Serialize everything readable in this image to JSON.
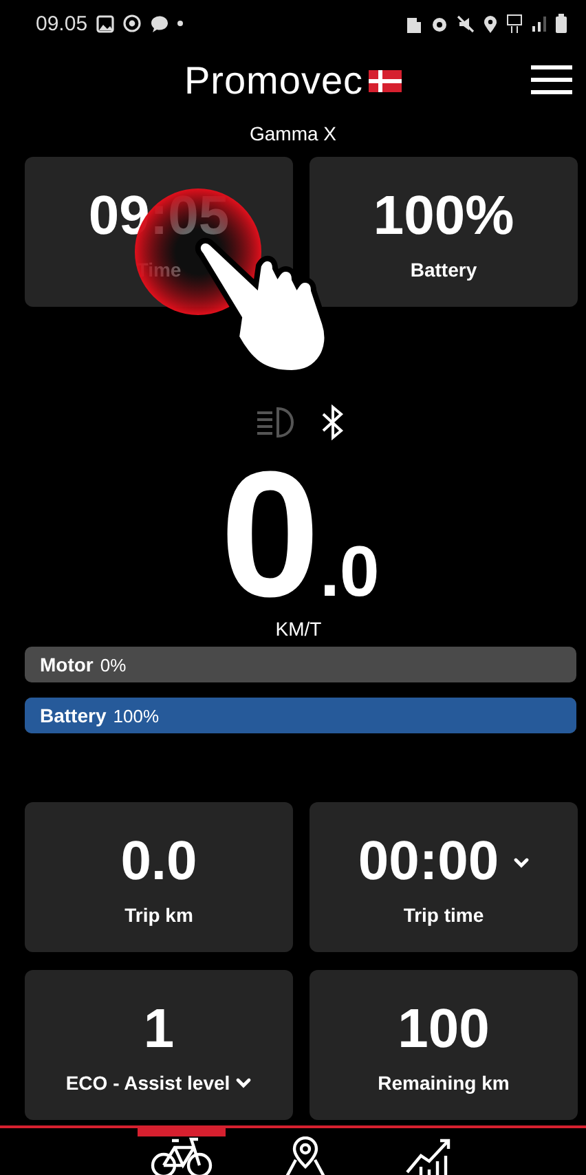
{
  "status_bar": {
    "time": "09.05"
  },
  "header": {
    "logo": "Promovec",
    "device": "Gamma X"
  },
  "top_tiles": [
    {
      "value": "09:05",
      "label": "Time"
    },
    {
      "value": "100%",
      "label": "Battery"
    }
  ],
  "indicators": [
    {
      "kind": "headlight",
      "on": false
    },
    {
      "kind": "bluetooth",
      "on": true
    }
  ],
  "speed": {
    "whole": "0",
    "decimal": ".0",
    "unit": "KM/T"
  },
  "bars": [
    {
      "label": "Motor",
      "reading": "0%",
      "level": 0
    },
    {
      "label": "Battery",
      "reading": "100%",
      "level": 1,
      "color": "#265a9a"
    }
  ],
  "stat_tiles": [
    {
      "value": "0.0",
      "label": "Trip km",
      "value_dropdown": false,
      "label_dropdown": false
    },
    {
      "value": "00:00",
      "label": "Trip time",
      "value_dropdown": true,
      "label_dropdown": false
    },
    {
      "value": "1",
      "label": "ECO - Assist level",
      "value_dropdown": false,
      "label_dropdown": true
    },
    {
      "value": "100",
      "label": "Remaining km",
      "value_dropdown": false,
      "label_dropdown": false
    }
  ],
  "nav": [
    {
      "kind": "bike",
      "selected": true
    },
    {
      "kind": "map",
      "selected": false
    },
    {
      "kind": "chart",
      "selected": false
    }
  ]
}
